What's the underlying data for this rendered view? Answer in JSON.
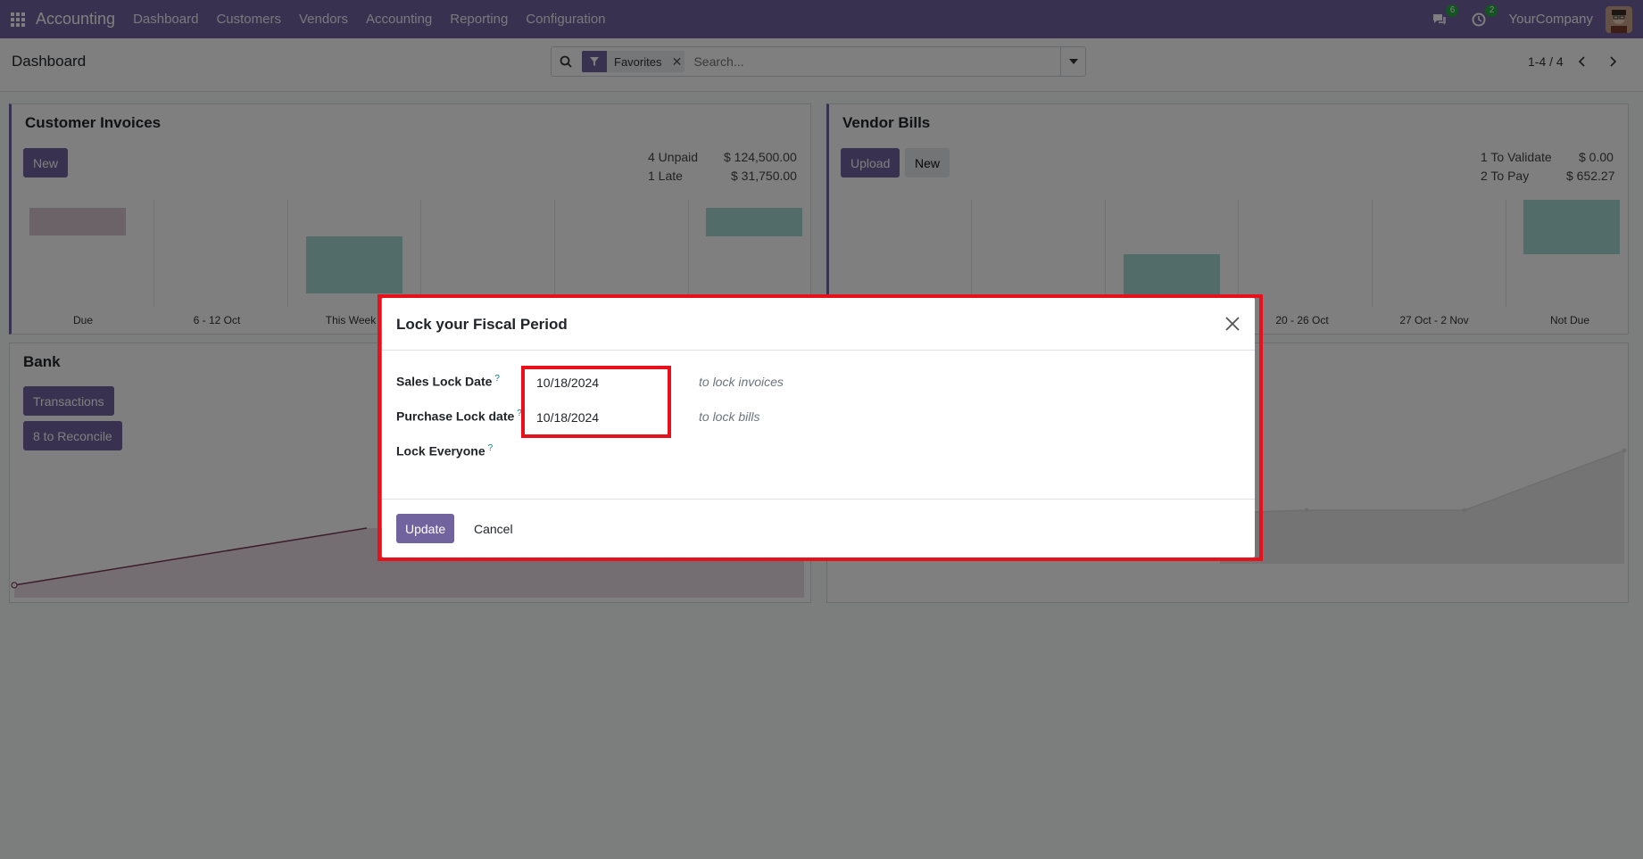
{
  "navbar": {
    "app_name": "Accounting",
    "menu": [
      "Dashboard",
      "Customers",
      "Vendors",
      "Accounting",
      "Reporting",
      "Configuration"
    ],
    "messages_count": "6",
    "activities_count": "2",
    "company": "YourCompany",
    "color": "#71639e"
  },
  "control_panel": {
    "breadcrumb": "Dashboard",
    "search": {
      "facet_label": "Favorites",
      "placeholder": "Search..."
    },
    "pager": "1-4 / 4"
  },
  "customer_invoices": {
    "title": "Customer Invoices",
    "new_label": "New",
    "stats": [
      {
        "label": "4 Unpaid",
        "value": "$ 124,500.00"
      },
      {
        "label": "1 Late",
        "value": "$ 31,750.00"
      }
    ],
    "chart_labels": [
      "Due",
      "6 - 12 Oct",
      "This Week"
    ]
  },
  "vendor_bills": {
    "title": "Vendor Bills",
    "upload_label": "Upload",
    "new_label": "New",
    "stats": [
      {
        "label": "1 To Validate",
        "value": "$ 0.00"
      },
      {
        "label": "2 To Pay",
        "value": "$ 652.27"
      }
    ],
    "chart_labels": [
      "20 - 26 Oct",
      "27 Oct - 2 Nov",
      "Not Due"
    ]
  },
  "bank": {
    "title": "Bank",
    "transactions_label": "Transactions",
    "reconcile_label": "8 to Reconcile"
  },
  "dialog": {
    "title": "Lock your Fiscal Period",
    "fields": [
      {
        "label": "Sales Lock Date",
        "help": "?",
        "value": "10/18/2024",
        "hint": "to lock invoices"
      },
      {
        "label": "Purchase Lock date",
        "help": "?",
        "value": "10/18/2024",
        "hint": "to lock bills"
      },
      {
        "label": "Lock Everyone",
        "help": "?",
        "value": "",
        "hint": ""
      }
    ],
    "update_label": "Update",
    "cancel_label": "Cancel"
  },
  "icons": {
    "apps": "apps-grid-icon",
    "messages": "chat-icon",
    "activities": "clock-icon",
    "search": "search-icon",
    "filter": "filter-icon",
    "close": "close-icon",
    "caret": "caret-down-icon",
    "prev": "chevron-left-icon",
    "next": "chevron-right-icon"
  },
  "colors": {
    "highlight": "#e8101a",
    "bar_teal": "#a3d9d3",
    "bar_muted": "#d9c7d0"
  }
}
